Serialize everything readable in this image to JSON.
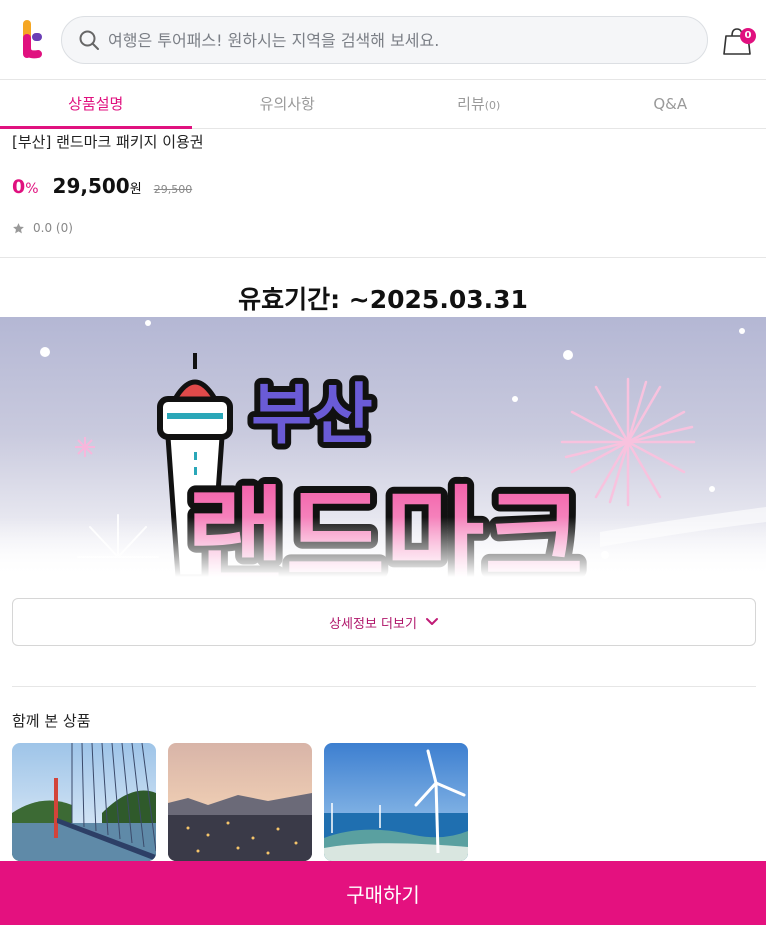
{
  "header": {
    "search_placeholder": "여행은 투어패스! 원하시는 지역을 검색해 보세요.",
    "cart_count": "0"
  },
  "tabs": [
    {
      "label": "상품설명",
      "active": true
    },
    {
      "label": "유의사항"
    },
    {
      "label": "리뷰",
      "count": "(0)"
    },
    {
      "label": "Q&A"
    }
  ],
  "product": {
    "title": "[부산] 랜드마크 패키지 이용권",
    "discount": "0",
    "discount_unit": "%",
    "price": "29,500",
    "price_unit": "원",
    "original_price": "29,500",
    "rating": "0.0",
    "review_count": "(0)"
  },
  "validity": "유효기간: ~2025.03.31",
  "banner": {
    "line1": "부산",
    "line2": "랜드마크"
  },
  "more_button": "상세정보 더보기",
  "together": {
    "title": "함께 본 상품"
  },
  "buy_button": "구매하기",
  "colors": {
    "accent": "#e0117f",
    "buy_bar": "#e4117f"
  }
}
